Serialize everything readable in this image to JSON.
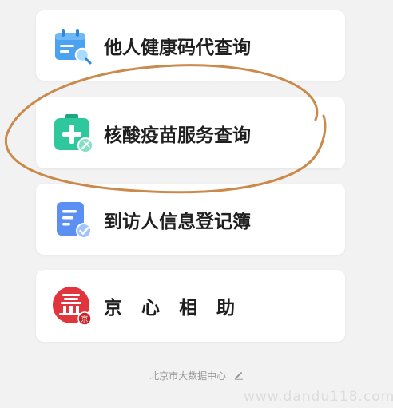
{
  "menu": {
    "items": [
      {
        "label": "他人健康码代查询",
        "icon": "calendar-search-icon"
      },
      {
        "label": "核酸疫苗服务查询",
        "icon": "medical-kit-icon"
      },
      {
        "label": "到访人信息登记簿",
        "icon": "document-check-icon"
      },
      {
        "label": "京心相助",
        "icon": "jingxin-logo-icon"
      }
    ]
  },
  "footer": {
    "text": "北京市大数据中心",
    "icon": "pencil-icon"
  },
  "watermark": {
    "text": "www.dandu118.com"
  },
  "colors": {
    "background": "#f2f2f2",
    "card": "#ffffff",
    "hand_drawn_circle": "#c98a4b",
    "health_icon_blue": "#4ba3f0",
    "vaccine_icon_green": "#2fc79c",
    "visitor_icon_blue": "#5b8ff2",
    "jingxin_red": "#e2343c"
  }
}
